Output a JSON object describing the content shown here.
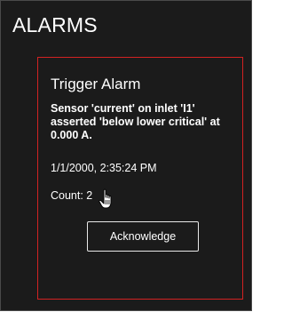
{
  "panel": {
    "title": "ALARMS"
  },
  "alarm": {
    "title": "Trigger Alarm",
    "message": "Sensor 'current' on inlet 'I1' asserted 'below lower critical' at 0.000 A.",
    "timestamp": "1/1/2000, 2:35:24 PM",
    "count": "Count: 2",
    "acknowledge_label": "Acknowledge"
  },
  "icons": {
    "cursor": "hand-pointer-icon"
  },
  "colors": {
    "panel_background": "#1b1b1b",
    "alarm_border": "#d32222",
    "text": "#ffffff",
    "button_border": "#e8e8e8"
  }
}
